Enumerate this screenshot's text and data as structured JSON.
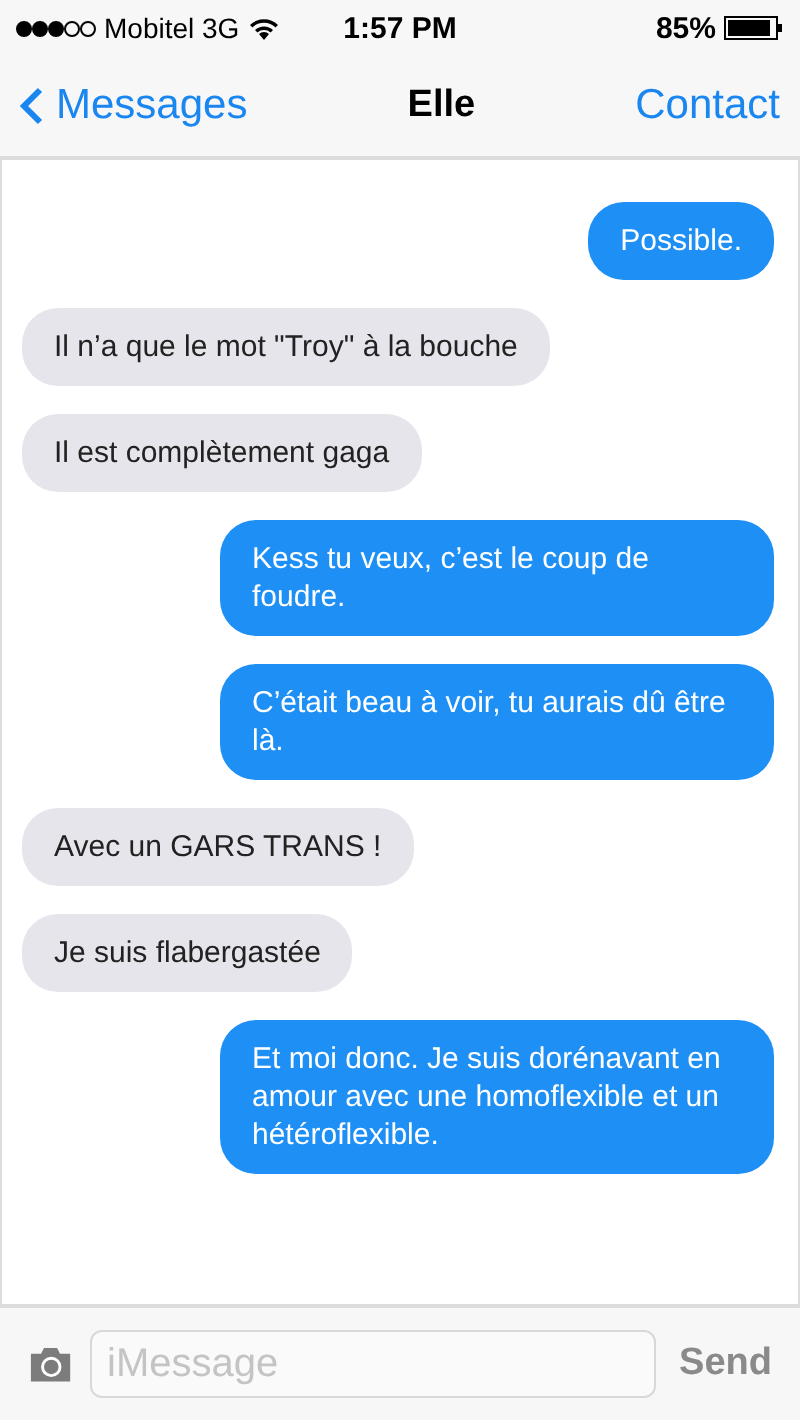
{
  "status_bar": {
    "carrier": "Mobitel 3G",
    "time": "1:57 PM",
    "battery": "85%"
  },
  "nav": {
    "back": "Messages",
    "title": "Elle",
    "action": "Contact"
  },
  "messages": [
    {
      "kind": "sent",
      "text": "Possible."
    },
    {
      "kind": "received",
      "text": "Il n’a que le mot \"Troy\" à la bouche"
    },
    {
      "kind": "received",
      "text": "Il est complètement gaga"
    },
    {
      "kind": "sent",
      "text": "Kess tu veux, c’est le coup de foudre."
    },
    {
      "kind": "sent",
      "text": "C’était beau à voir, tu aurais dû être là."
    },
    {
      "kind": "received",
      "text": "Avec un GARS TRANS !"
    },
    {
      "kind": "received",
      "text": "Je suis flabergastée"
    },
    {
      "kind": "sent",
      "text": "Et moi donc. Je suis dorénavant en amour avec une homoflexible et un hétéroflexible."
    }
  ],
  "compose": {
    "placeholder": "iMessage",
    "send": "Send"
  }
}
